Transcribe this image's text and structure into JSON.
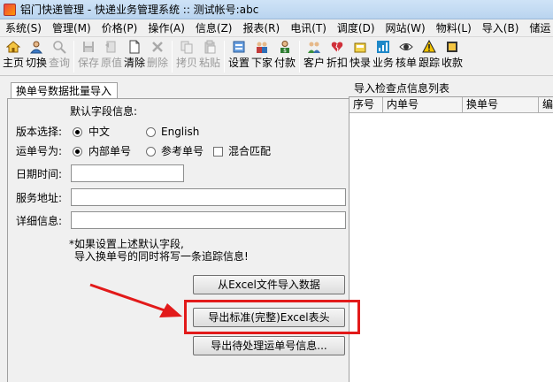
{
  "window": {
    "title": "铝门快递管理 - 快递业务管理系统 :: 测试帐号:abc"
  },
  "menu": [
    {
      "label": "系统(S)"
    },
    {
      "label": "管理(M)"
    },
    {
      "label": "价格(P)"
    },
    {
      "label": "操作(A)"
    },
    {
      "label": "信息(Z)"
    },
    {
      "label": "报表(R)"
    },
    {
      "label": "电讯(T)"
    },
    {
      "label": "调度(D)"
    },
    {
      "label": "网站(W)"
    },
    {
      "label": "物料(L)"
    },
    {
      "label": "导入(B)"
    },
    {
      "label": "储运"
    }
  ],
  "toolbar": {
    "home": "主页",
    "switch": "切换",
    "query": "查询",
    "save": "保存",
    "restore": "原值",
    "clear": "清除",
    "delete": "删除",
    "copy": "拷贝",
    "paste": "粘贴",
    "settings": "设置",
    "dispatch": "下家",
    "payment": "付款",
    "customer": "客户",
    "discount": "折扣",
    "quicklist": "快录",
    "business": "业务",
    "verify": "核单",
    "track": "跟踪",
    "collect": "收款"
  },
  "left": {
    "tab": "换单号数据批量导入",
    "defaults_heading": "默认字段信息:",
    "version_label": "版本选择:",
    "version_cn": "中文",
    "version_en": "English",
    "waybill_label": "运单号为:",
    "waybill_internal": "内部单号",
    "waybill_reference": "参考单号",
    "waybill_mixed": "混合匹配",
    "date_label": "日期时间:",
    "service_label": "服务地址:",
    "detail_label": "详细信息:",
    "note_line1": "*如果设置上述默认字段,",
    "note_line2": "导入换单号的同时将写一条追踪信息!",
    "btn_import": "从Excel文件导入数据",
    "btn_export_template": "导出标准(完整)Excel表头",
    "btn_export_pending": "导出待处理运单号信息..."
  },
  "right": {
    "title": "导入检查点信息列表",
    "columns": [
      "序号",
      "内单号",
      "换单号",
      "编"
    ]
  },
  "colors": {
    "highlight": "#e21a1a"
  }
}
